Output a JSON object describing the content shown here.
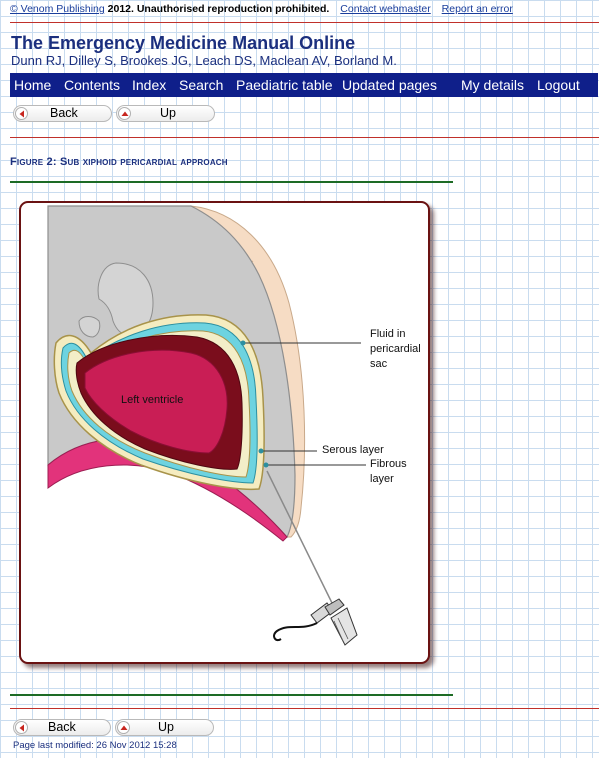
{
  "header": {
    "copyright_link": "© Venom Publishing",
    "copyright_text": "2012. Unauthorised reproduction prohibited.",
    "contact_link": "Contact webmaster",
    "report_link": "Report an error",
    "title": "The Emergency Medicine Manual Online",
    "authors": "Dunn RJ, Dilley S, Brookes JG, Leach DS, Maclean AV, Borland M."
  },
  "nav": {
    "home": "Home",
    "contents": "Contents",
    "index": "Index",
    "search": "Search",
    "paediatric": "Paediatric table",
    "updated": "Updated pages",
    "mydetails": "My details",
    "logout": "Logout"
  },
  "buttons": {
    "back": "Back",
    "up": "Up"
  },
  "figure": {
    "caption": "Figure 2: Sub xiphoid pericardial approach",
    "labels": {
      "left_ventricle": "Left ventricle",
      "fluid_line1": "Fluid in",
      "fluid_line2": "pericardial",
      "fluid_line3": "sac",
      "serous": "Serous layer",
      "fibrous_line1": "Fibrous",
      "fibrous_line2": "layer"
    }
  },
  "footer": {
    "last_modified": "Page last modified: 26 Nov 2012 15:28"
  },
  "colors": {
    "nav_bg": "#0f1f8a",
    "title": "#1b2f7e",
    "rule_red": "#c0302a",
    "rule_green": "#1d6b25"
  }
}
